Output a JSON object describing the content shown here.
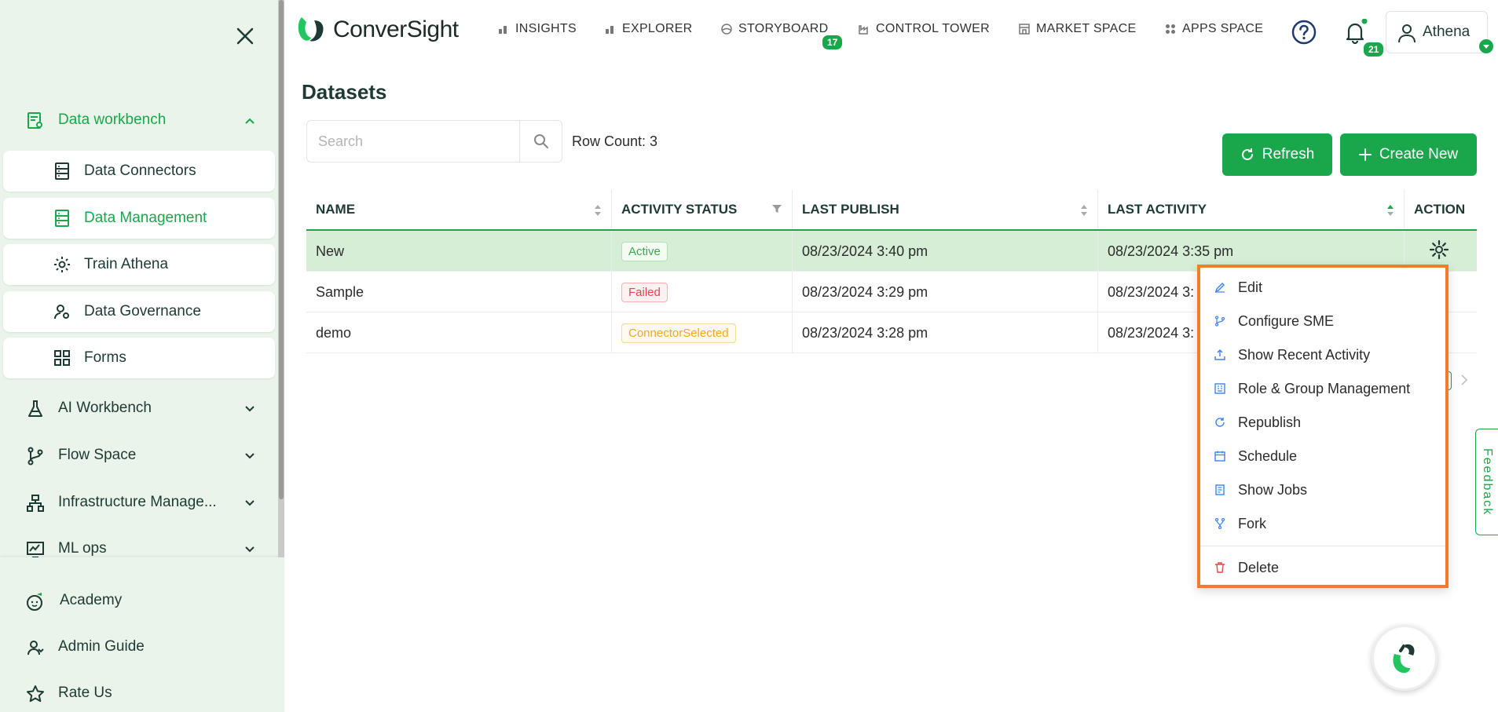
{
  "sidebar": {
    "groups": [
      {
        "label": "Data workbench",
        "icon": "data-workbench-icon"
      },
      {
        "label": "AI Workbench",
        "icon": "flask-icon"
      },
      {
        "label": "Flow Space",
        "icon": "branch-icon"
      },
      {
        "label": "Infrastructure Manage...",
        "icon": "hierarchy-icon"
      },
      {
        "label": "ML ops",
        "icon": "chart-monitor-icon"
      }
    ],
    "sub_items": [
      {
        "label": "Data Connectors",
        "icon": "server-icon"
      },
      {
        "label": "Data Management",
        "icon": "server-icon"
      },
      {
        "label": "Train Athena",
        "icon": "gear-icon"
      },
      {
        "label": "Data Governance",
        "icon": "user-settings-icon"
      },
      {
        "label": "Forms",
        "icon": "grid-icon"
      }
    ],
    "bottom": [
      {
        "label": "Academy",
        "icon": "academy-icon"
      },
      {
        "label": "Admin Guide",
        "icon": "user-guide-icon"
      },
      {
        "label": "Rate Us",
        "icon": "star-icon"
      }
    ]
  },
  "topbar": {
    "logo_text": "ConverSight",
    "nav": [
      {
        "label": "INSIGHTS"
      },
      {
        "label": "EXPLORER"
      },
      {
        "label": "STORYBOARD"
      },
      {
        "label": "CONTROL TOWER"
      },
      {
        "label": "MARKET SPACE"
      },
      {
        "label": "APPS SPACE"
      }
    ],
    "storyboard_badge": "17",
    "notifications_badge": "21",
    "user_name": "Athena"
  },
  "page": {
    "title": "Datasets",
    "search_placeholder": "Search",
    "row_count": "Row Count: 3",
    "refresh_label": "Refresh",
    "create_label": "Create New"
  },
  "table": {
    "columns": [
      "NAME",
      "ACTIVITY STATUS",
      "LAST PUBLISH",
      "LAST ACTIVITY",
      "ACTION"
    ],
    "rows": [
      {
        "name": "New",
        "status": "Active",
        "last_publish": "08/23/2024 3:40 pm",
        "last_activity": "08/23/2024 3:35 pm"
      },
      {
        "name": "Sample",
        "status": "Failed",
        "last_publish": "08/23/2024 3:29 pm",
        "last_activity": "08/23/2024 3:"
      },
      {
        "name": "demo",
        "status": "ConnectorSelected",
        "last_publish": "08/23/2024 3:28 pm",
        "last_activity": "08/23/2024 3:"
      }
    ]
  },
  "action_menu": {
    "items": [
      {
        "label": "Edit",
        "icon": "pencil-icon"
      },
      {
        "label": "Configure SME",
        "icon": "branch-icon"
      },
      {
        "label": "Show Recent Activity",
        "icon": "upload-icon"
      },
      {
        "label": "Role & Group Management",
        "icon": "building-icon"
      },
      {
        "label": "Republish",
        "icon": "refresh-icon"
      },
      {
        "label": "Schedule",
        "icon": "calendar-icon"
      },
      {
        "label": "Show Jobs",
        "icon": "jobs-icon"
      },
      {
        "label": "Fork",
        "icon": "fork-icon"
      }
    ],
    "delete_label": "Delete"
  },
  "feedback_label": "Feedback",
  "colors": {
    "brand_green": "#1aa64b",
    "sidebar_bg": "#eaf4ea",
    "highlight_orange": "#f07c2c",
    "failed_red": "#e0474c",
    "connector_orange": "#f5a623"
  }
}
